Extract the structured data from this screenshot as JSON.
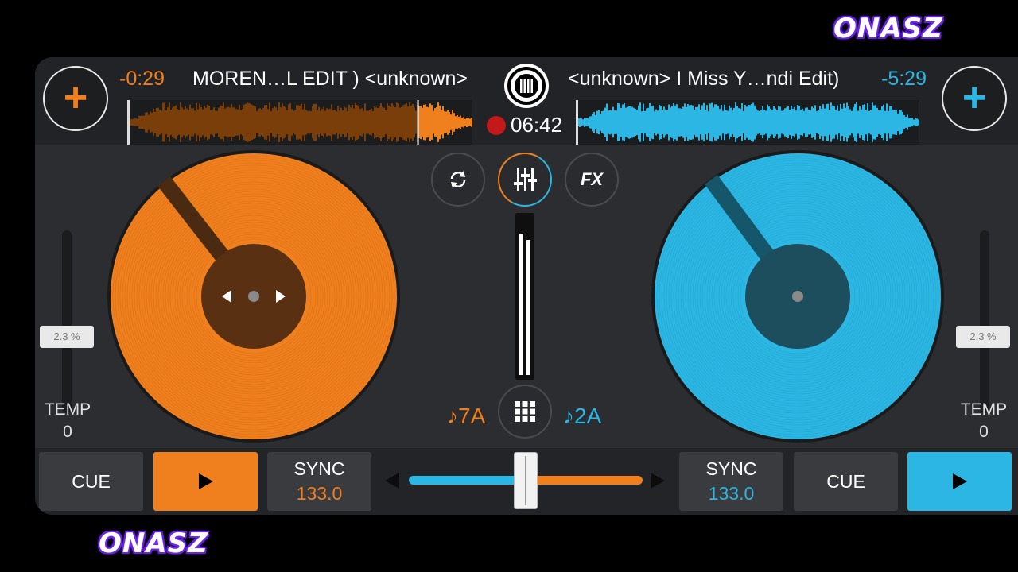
{
  "watermark": {
    "top": "ONASZ",
    "bottom": "ONASZ"
  },
  "colors": {
    "deck_a": "#f07f1e",
    "deck_b": "#2bb6e3",
    "record": "#c2191a"
  },
  "deck_a": {
    "add_icon": "plus-icon",
    "time_remaining": "-0:29",
    "track_title": "MOREN…L EDIT ) <unknown>",
    "playback_progress": 0.84,
    "platter_icons": [
      "arrow-left-icon",
      "arrow-right-icon"
    ],
    "tempo_value": "2.3 %",
    "tempo_label": "TEMP",
    "tempo_zero": "0",
    "key": "♪7A",
    "cue_label": "CUE",
    "play_icon": "play-icon",
    "sync_label": "SYNC",
    "bpm": "133.0"
  },
  "deck_b": {
    "add_icon": "plus-icon",
    "time_remaining": "-5:29",
    "track_title": "<unknown>   I Miss Y…ndi Edit)",
    "playback_progress": 0.0,
    "tempo_value": "2.3 %",
    "tempo_label": "TEMP",
    "tempo_zero": "0",
    "key": "♪2A",
    "cue_label": "CUE",
    "play_icon": "play-icon",
    "sync_label": "SYNC",
    "bpm": "133.0"
  },
  "center": {
    "logo_icon": "vinyl-logo-icon",
    "recording_time": "06:42",
    "loop_icon": "loop-icon",
    "mixer_icon": "mixer-sliders-icon",
    "fx_label": "FX",
    "grid_icon": "grid-icon",
    "volume_levels": [
      0.9,
      0.86
    ],
    "crossfader_position": 0.5
  }
}
